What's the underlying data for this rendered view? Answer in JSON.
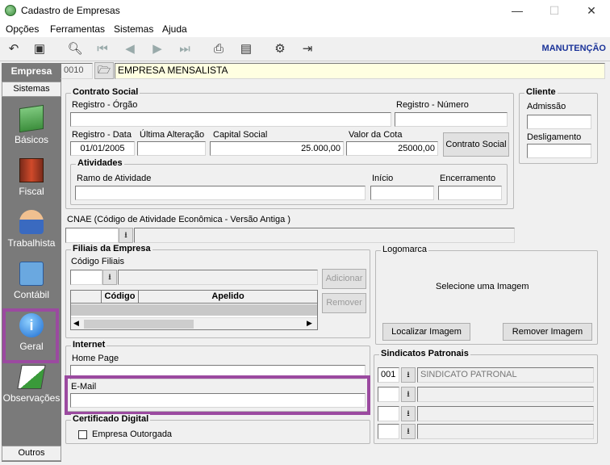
{
  "window": {
    "title": "Cadastro de Empresas",
    "minimize": "—",
    "maximize": "☐",
    "close": "✕"
  },
  "menu": [
    "Opções",
    "Ferramentas",
    "Sistemas",
    "Ajuda"
  ],
  "toolbar": {
    "mode_label": "MANUTENÇÃO"
  },
  "empresa": {
    "label": "Empresa",
    "code": "0010",
    "name": "EMPRESA MENSALISTA"
  },
  "sidebar": {
    "header": "Sistemas",
    "items": [
      {
        "label": "Básicos"
      },
      {
        "label": "Fiscal"
      },
      {
        "label": "Trabalhista"
      },
      {
        "label": "Contábil"
      },
      {
        "label": "Geral"
      },
      {
        "label": "Observações"
      }
    ],
    "footer": "Outros"
  },
  "contrato": {
    "title": "Contrato Social",
    "registro_orgao_label": "Registro - Órgão",
    "registro_orgao": "",
    "registro_numero_label": "Registro - Número",
    "registro_numero": "",
    "registro_data_label": "Registro - Data",
    "registro_data": "01/01/2005",
    "ultima_alteracao_label": "Última Alteração",
    "ultima_alteracao": "",
    "capital_social_label": "Capital Social",
    "capital_social": "25.000,00",
    "valor_cota_label": "Valor da Cota",
    "valor_cota": "25000,00",
    "contrato_button": "Contrato Social"
  },
  "atividades": {
    "title": "Atividades",
    "ramo_label": "Ramo de Atividade",
    "inicio_label": "Início",
    "encerramento_label": "Encerramento"
  },
  "cliente": {
    "title": "Cliente",
    "admissao_label": "Admissão",
    "desligamento_label": "Desligamento"
  },
  "cnae": {
    "label": "CNAE (Código de Atividade Econômica - Versão Antiga )"
  },
  "filiais": {
    "title": "Filiais da Empresa",
    "codigo_label": "Código Filiais",
    "columns": [
      "Código",
      "Apelido"
    ],
    "add_button": "Adicionar",
    "remove_button": "Remover"
  },
  "logomarca": {
    "title": "Logomarca",
    "placeholder": "Selecione  uma   Imagem",
    "locate_button": "Localizar Imagem",
    "remove_button": "Remover Imagem"
  },
  "internet": {
    "title": "Internet",
    "homepage_label": "Home Page",
    "email_label": "E-Mail"
  },
  "sindicatos": {
    "title": "Sindicatos Patronais",
    "rows": [
      {
        "code": "001",
        "name": "SINDICATO PATRONAL"
      },
      {
        "code": "",
        "name": ""
      },
      {
        "code": "",
        "name": ""
      },
      {
        "code": "",
        "name": ""
      }
    ]
  },
  "certificado": {
    "title": "Certificado Digital",
    "checkbox_label": "Empresa Outorgada"
  },
  "colors": {
    "highlight": "#9b4aa0",
    "sidebar": "#7a7a7a",
    "accent": "#1a3399",
    "empresa_field": "#ffffe1"
  }
}
